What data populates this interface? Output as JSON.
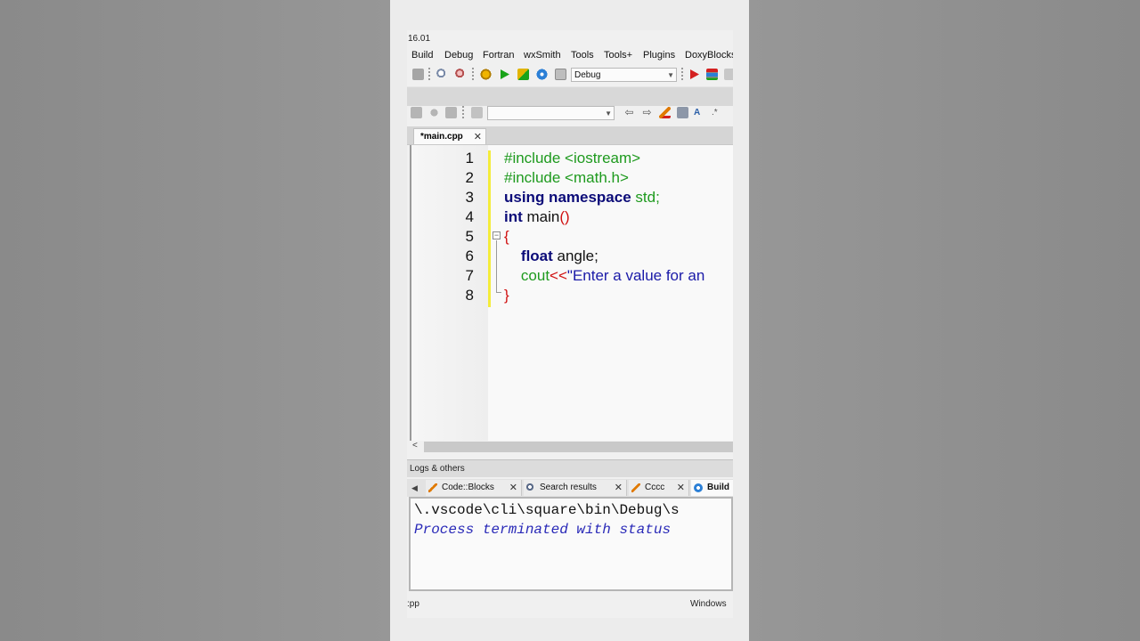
{
  "app": {
    "version": "16.01"
  },
  "menu": [
    "Build",
    "Debug",
    "Fortran",
    "wxSmith",
    "Tools",
    "Tools+",
    "Plugins",
    "DoxyBlocks"
  ],
  "toolbar": {
    "build_target": "Debug"
  },
  "editor": {
    "tab_label": "*main.cpp",
    "line_numbers": [
      "1",
      "2",
      "3",
      "4",
      "5",
      "6",
      "7",
      "8"
    ],
    "lines": [
      {
        "parts": [
          {
            "t": "#include <iostream>",
            "c": "pre"
          }
        ]
      },
      {
        "parts": [
          {
            "t": "#include <math.h>",
            "c": "pre"
          }
        ]
      },
      {
        "parts": [
          {
            "t": "using namespace",
            "c": "kw"
          },
          {
            "t": " ",
            "c": "plain"
          },
          {
            "t": "std;",
            "c": "pre"
          }
        ]
      },
      {
        "parts": [
          {
            "t": "int",
            "c": "kw"
          },
          {
            "t": " main",
            "c": "plain"
          },
          {
            "t": "()",
            "c": "op"
          }
        ]
      },
      {
        "parts": [
          {
            "t": "{",
            "c": "op"
          }
        ]
      },
      {
        "parts": [
          {
            "t": "    ",
            "c": "plain"
          },
          {
            "t": "float",
            "c": "kw"
          },
          {
            "t": " angle;",
            "c": "plain"
          }
        ]
      },
      {
        "parts": [
          {
            "t": "    ",
            "c": "plain"
          },
          {
            "t": "cout",
            "c": "pre"
          },
          {
            "t": "<<",
            "c": "op"
          },
          {
            "t": "\"Enter a value for an",
            "c": "str"
          }
        ]
      },
      {
        "parts": [
          {
            "t": "}",
            "c": "op"
          }
        ]
      }
    ]
  },
  "logs": {
    "header": "Logs & others",
    "tabs": [
      "Code::Blocks",
      "Search results",
      "Cccc",
      "Build"
    ],
    "output_line1": "\\.vscode\\cli\\square\\bin\\Debug\\s",
    "output_line2": "Process terminated with status"
  },
  "status": {
    "left": ":pp",
    "right": "Windows"
  },
  "colors": {
    "preprocessor": "#1e9a1e",
    "keyword": "#0b0b78",
    "string": "#1a1aa8",
    "operator": "#d01010",
    "change_bar": "#f4ec3a"
  }
}
